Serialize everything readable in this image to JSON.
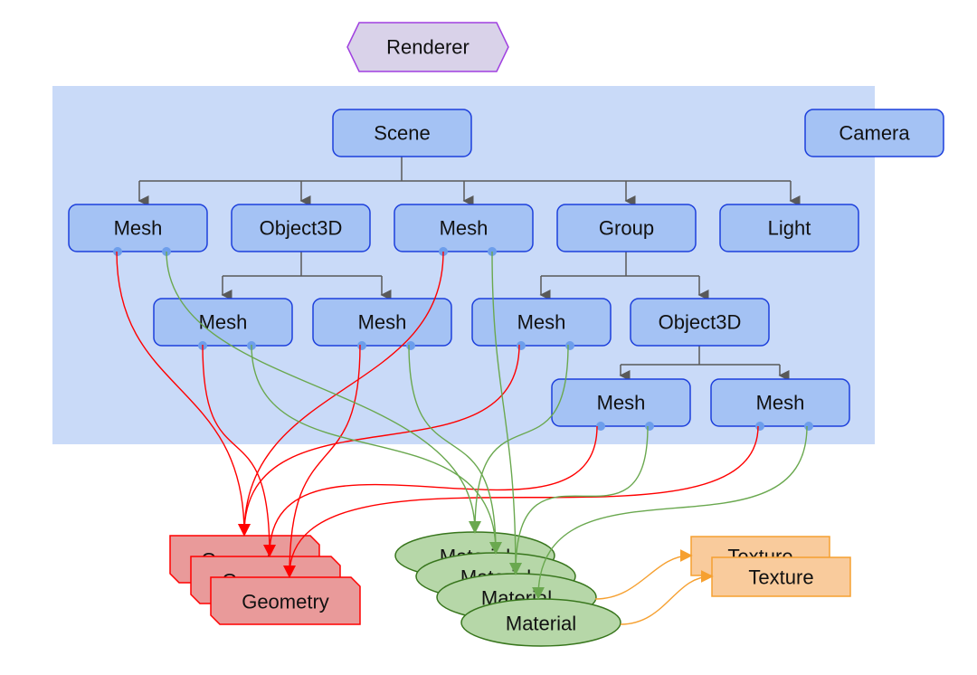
{
  "renderer": {
    "label": "Renderer"
  },
  "scene": {
    "label": "Scene"
  },
  "camera": {
    "label": "Camera"
  },
  "row1": [
    {
      "label": "Mesh"
    },
    {
      "label": "Object3D"
    },
    {
      "label": "Mesh"
    },
    {
      "label": "Group"
    },
    {
      "label": "Light"
    }
  ],
  "row2": [
    {
      "label": "Mesh"
    },
    {
      "label": "Mesh"
    },
    {
      "label": "Mesh"
    },
    {
      "label": "Object3D"
    }
  ],
  "row3": [
    {
      "label": "Mesh"
    },
    {
      "label": "Mesh"
    }
  ],
  "geometries": [
    {
      "label": "Geometry"
    },
    {
      "label": "Geometry"
    },
    {
      "label": "Geometry"
    }
  ],
  "materials": [
    {
      "label": "Material"
    },
    {
      "label": "Material"
    },
    {
      "label": "Material"
    },
    {
      "label": "Material"
    }
  ],
  "textures": [
    {
      "label": "Texture"
    },
    {
      "label": "Texture"
    }
  ],
  "colors": {
    "scene_region": "#c9daf8",
    "node_fill": "#a4c2f4",
    "node_stroke": "#1c3fdc",
    "geometry_edge": "#ff0000",
    "material_edge": "#6aa84f",
    "texture_edge": "#f6a030",
    "renderer_fill": "#d9d2e9",
    "renderer_stroke": "#a040e0"
  }
}
